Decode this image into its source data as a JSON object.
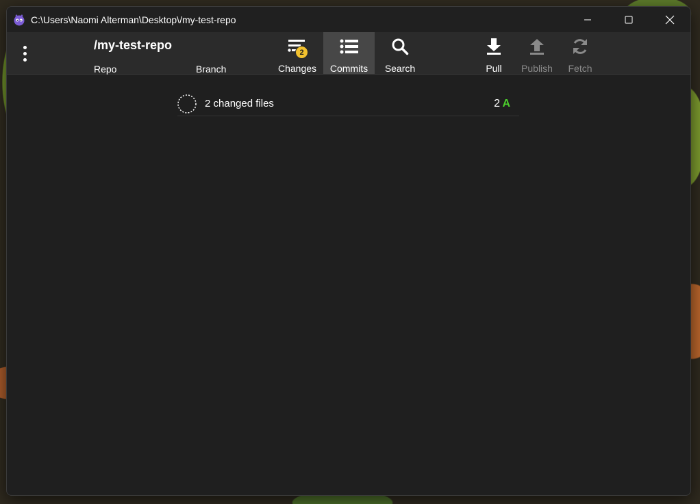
{
  "window": {
    "title": "C:\\Users\\Naomi Alterman\\Desktop\\/my-test-repo",
    "controls": [
      "minimize-icon",
      "maximize-icon",
      "close-icon"
    ]
  },
  "toolbar": {
    "repo_name": "/my-test-repo",
    "repo_label": "Repo",
    "branch_label": "Branch",
    "buttons": [
      {
        "label": "Changes",
        "icon": "changes-icon",
        "badge": "2",
        "active": false,
        "enabled": true
      },
      {
        "label": "Commits",
        "icon": "list-icon",
        "active": true,
        "enabled": true
      },
      {
        "label": "Search",
        "icon": "search-icon",
        "active": false,
        "enabled": true
      },
      {
        "label": "Pull",
        "icon": "download-icon",
        "active": false,
        "enabled": true
      },
      {
        "label": "Publish",
        "icon": "upload-icon",
        "active": false,
        "enabled": false
      },
      {
        "label": "Fetch",
        "icon": "refresh-icon",
        "active": false,
        "enabled": false
      }
    ]
  },
  "changes": {
    "summary": "2 changed files",
    "count": "2",
    "status": "A"
  },
  "colors": {
    "badge": "#f2c12e",
    "added_status": "#4ccf2c",
    "active_tab": "#474747",
    "background": "#1f1f1f"
  }
}
